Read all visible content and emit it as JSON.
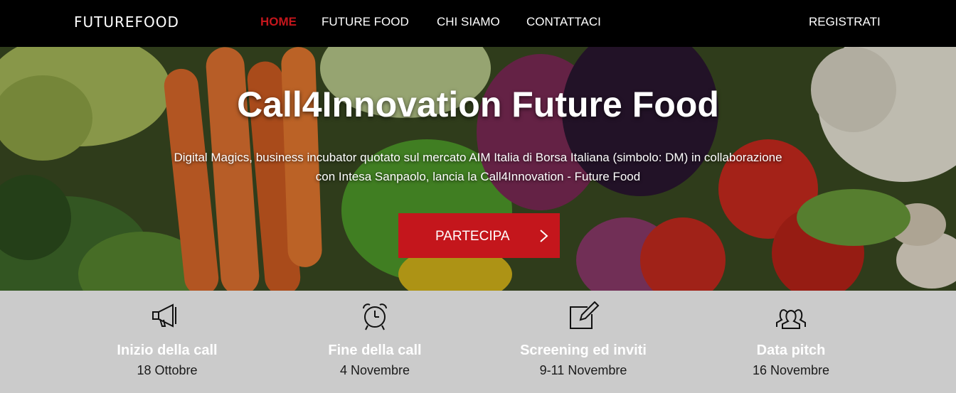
{
  "nav": {
    "logo": "FUTUREFOOD",
    "links": [
      {
        "label": "HOME",
        "active": true
      },
      {
        "label": "FUTURE FOOD",
        "active": false
      },
      {
        "label": "CHI SIAMO",
        "active": false
      },
      {
        "label": "CONTATTACI",
        "active": false
      }
    ],
    "register": "REGISTRATI"
  },
  "hero": {
    "title": "Call4Innovation Future Food",
    "text": "Digital Magics, business incubator quotato sul mercato AIM Italia di Borsa Italiana (simbolo: DM) in collaborazione con Intesa Sanpaolo, lancia la Call4Innovation - Future Food",
    "cta": "PARTECIPA",
    "cta_icon": "chevron-right-icon"
  },
  "steps": [
    {
      "icon": "megaphone-icon",
      "title": "Inizio della call",
      "date": "18 Ottobre"
    },
    {
      "icon": "alarm-clock-icon",
      "title": "Fine della call",
      "date": "4 Novembre"
    },
    {
      "icon": "edit-icon",
      "title": "Screening ed inviti",
      "date": "9-11 Novembre"
    },
    {
      "icon": "people-icon",
      "title": "Data pitch",
      "date": "16 Novembre"
    }
  ],
  "colors": {
    "accent": "#c4161c",
    "nav_bg": "#000000",
    "steps_bg": "#cbcbcb"
  }
}
